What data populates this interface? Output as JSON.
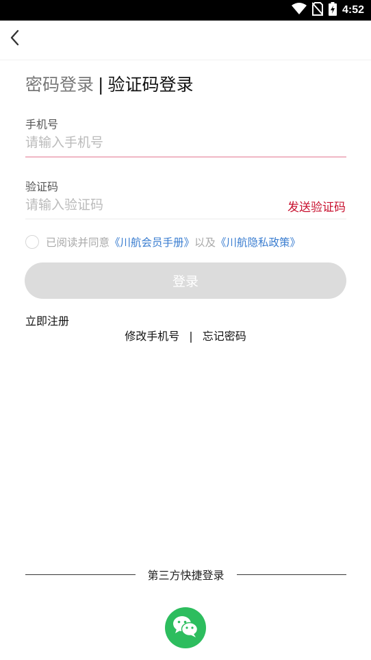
{
  "status_bar": {
    "time": "4:52",
    "icons": [
      "wifi-icon",
      "no-sim-icon",
      "battery-charging-icon"
    ]
  },
  "nav": {
    "back_icon": "chevron-left-icon"
  },
  "tabs": {
    "password_login": "密码登录",
    "separator": "|",
    "code_login": "验证码登录"
  },
  "phone": {
    "label": "手机号",
    "placeholder": "请输入手机号"
  },
  "code": {
    "label": "验证码",
    "placeholder": "请输入验证码",
    "send_button": "发送验证码"
  },
  "agreement": {
    "prefix": "已阅读并同意",
    "link1": "《川航会员手册》",
    "connector": "以及",
    "link2": "《川航隐私政策》"
  },
  "login_button": "登录",
  "register": "立即注册",
  "links": {
    "change_phone": "修改手机号",
    "separator": "|",
    "forgot_password": "忘记密码"
  },
  "third_party": {
    "label": "第三方快捷登录",
    "icon": "wechat-icon"
  },
  "colors": {
    "accent_red": "#c8102e",
    "link_blue": "#3a7dd0",
    "wechat_green": "#2dbd5e",
    "button_disabled": "#dcdcdc"
  }
}
